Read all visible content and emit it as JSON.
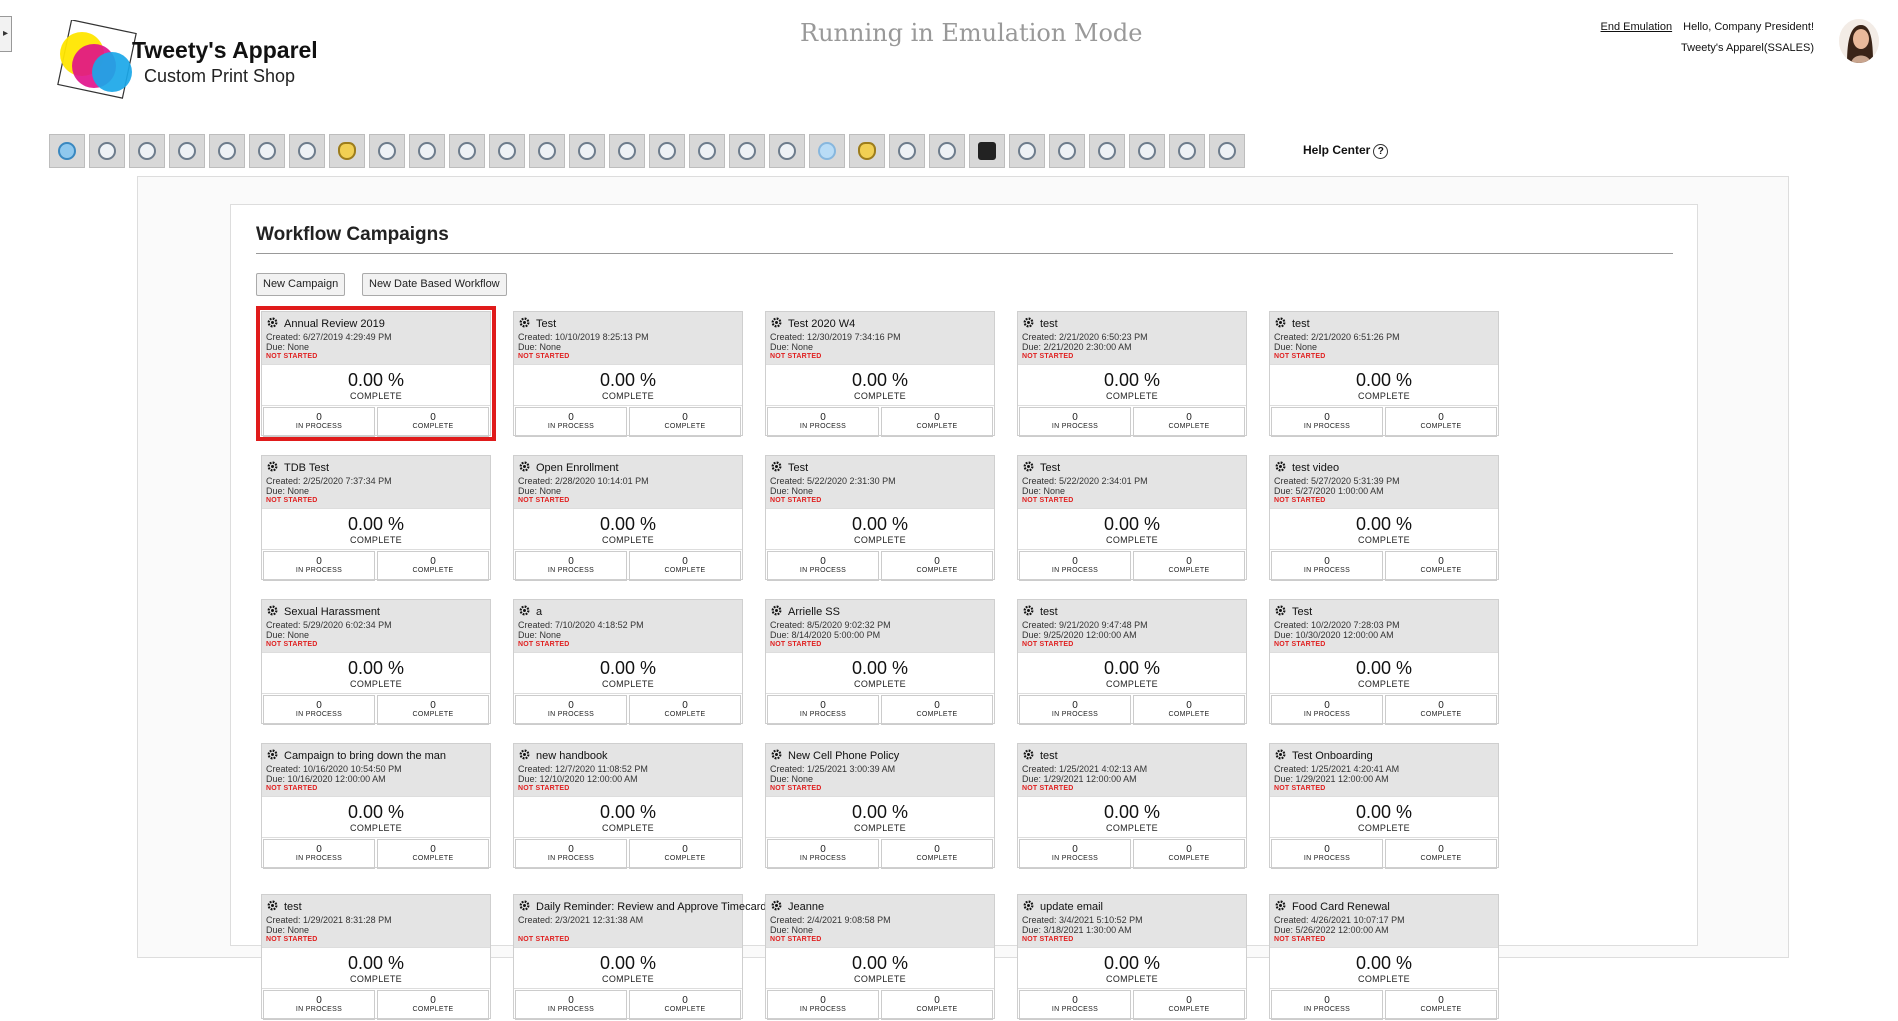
{
  "header": {
    "emulation_text": "Running in Emulation Mode",
    "end_emulation_label": "End Emulation",
    "greeting": "Hello, Company President!",
    "company": "Tweety's Apparel(SSALES)"
  },
  "logo": {
    "title": "Tweety's Apparel",
    "subtitle": "Custom Print Shop"
  },
  "toolbar": {
    "icons": [
      "home-icon",
      "award-icon",
      "settings-money-icon",
      "presentation-icon",
      "group-icon",
      "org-chart-icon",
      "document-edit-icon",
      "money-bag-icon",
      "search-people-icon",
      "target-icon",
      "target-icon",
      "growth-icon",
      "target-icon",
      "compare-icon",
      "handshake-icon",
      "shield-icon",
      "person-award-icon",
      "transfer-icon",
      "search-x-icon",
      "globe-icon",
      "money-bag-icon",
      "handshake-icon",
      "coins-icon",
      "clipboard-plus-icon",
      "shield-icon",
      "magnify-doc-icon",
      "id-card-icon",
      "document-icon",
      "team-icon",
      "inspect-icon"
    ],
    "help_label": "Help Center",
    "help_glyph": "?"
  },
  "page": {
    "title": "Workflow Campaigns",
    "new_campaign_label": "New Campaign",
    "new_date_workflow_label": "New Date Based Workflow"
  },
  "campaigns": [
    {
      "name": "Annual Review 2019",
      "created": "Created: 6/27/2019 4:29:49 PM",
      "due": "Due: None",
      "status": "NOT STARTED",
      "pct": "0.00 %",
      "pct_label": "COMPLETE",
      "in_process": "0",
      "in_process_label": "IN PROCESS",
      "complete": "0",
      "complete_label": "COMPLETE"
    },
    {
      "name": "Test",
      "created": "Created: 10/10/2019 8:25:13 PM",
      "due": "Due: None",
      "status": "NOT STARTED",
      "pct": "0.00 %",
      "pct_label": "COMPLETE",
      "in_process": "0",
      "in_process_label": "IN PROCESS",
      "complete": "0",
      "complete_label": "COMPLETE"
    },
    {
      "name": "Test 2020 W4",
      "created": "Created: 12/30/2019 7:34:16 PM",
      "due": "Due: None",
      "status": "NOT STARTED",
      "pct": "0.00 %",
      "pct_label": "COMPLETE",
      "in_process": "0",
      "in_process_label": "IN PROCESS",
      "complete": "0",
      "complete_label": "COMPLETE"
    },
    {
      "name": "test",
      "created": "Created: 2/21/2020 6:50:23 PM",
      "due": "Due: 2/21/2020 2:30:00 AM",
      "status": "NOT STARTED",
      "pct": "0.00 %",
      "pct_label": "COMPLETE",
      "in_process": "0",
      "in_process_label": "IN PROCESS",
      "complete": "0",
      "complete_label": "COMPLETE"
    },
    {
      "name": "test",
      "created": "Created: 2/21/2020 6:51:26 PM",
      "due": "Due: None",
      "status": "NOT STARTED",
      "pct": "0.00 %",
      "pct_label": "COMPLETE",
      "in_process": "0",
      "in_process_label": "IN PROCESS",
      "complete": "0",
      "complete_label": "COMPLETE"
    },
    {
      "name": "TDB Test",
      "created": "Created: 2/25/2020 7:37:34 PM",
      "due": "Due: None",
      "status": "NOT STARTED",
      "pct": "0.00 %",
      "pct_label": "COMPLETE",
      "in_process": "0",
      "in_process_label": "IN PROCESS",
      "complete": "0",
      "complete_label": "COMPLETE"
    },
    {
      "name": "Open Enrollment",
      "created": "Created: 2/28/2020 10:14:01 PM",
      "due": "Due: None",
      "status": "NOT STARTED",
      "pct": "0.00 %",
      "pct_label": "COMPLETE",
      "in_process": "0",
      "in_process_label": "IN PROCESS",
      "complete": "0",
      "complete_label": "COMPLETE"
    },
    {
      "name": "Test",
      "created": "Created: 5/22/2020 2:31:30 PM",
      "due": "Due: None",
      "status": "NOT STARTED",
      "pct": "0.00 %",
      "pct_label": "COMPLETE",
      "in_process": "0",
      "in_process_label": "IN PROCESS",
      "complete": "0",
      "complete_label": "COMPLETE"
    },
    {
      "name": "Test",
      "created": "Created: 5/22/2020 2:34:01 PM",
      "due": "Due: None",
      "status": "NOT STARTED",
      "pct": "0.00 %",
      "pct_label": "COMPLETE",
      "in_process": "0",
      "in_process_label": "IN PROCESS",
      "complete": "0",
      "complete_label": "COMPLETE"
    },
    {
      "name": "test video",
      "created": "Created: 5/27/2020 5:31:39 PM",
      "due": "Due: 5/27/2020 1:00:00 AM",
      "status": "NOT STARTED",
      "pct": "0.00 %",
      "pct_label": "COMPLETE",
      "in_process": "0",
      "in_process_label": "IN PROCESS",
      "complete": "0",
      "complete_label": "COMPLETE"
    },
    {
      "name": "Sexual Harassment",
      "created": "Created: 5/29/2020 6:02:34 PM",
      "due": "Due: None",
      "status": "NOT STARTED",
      "pct": "0.00 %",
      "pct_label": "COMPLETE",
      "in_process": "0",
      "in_process_label": "IN PROCESS",
      "complete": "0",
      "complete_label": "COMPLETE"
    },
    {
      "name": "a",
      "created": "Created: 7/10/2020 4:18:52 PM",
      "due": "Due: None",
      "status": "NOT STARTED",
      "pct": "0.00 %",
      "pct_label": "COMPLETE",
      "in_process": "0",
      "in_process_label": "IN PROCESS",
      "complete": "0",
      "complete_label": "COMPLETE"
    },
    {
      "name": "Arrielle SS",
      "created": "Created: 8/5/2020 9:02:32 PM",
      "due": "Due: 8/14/2020 5:00:00 PM",
      "status": "NOT STARTED",
      "pct": "0.00 %",
      "pct_label": "COMPLETE",
      "in_process": "0",
      "in_process_label": "IN PROCESS",
      "complete": "0",
      "complete_label": "COMPLETE"
    },
    {
      "name": "test",
      "created": "Created: 9/21/2020 9:47:48 PM",
      "due": "Due: 9/25/2020 12:00:00 AM",
      "status": "NOT STARTED",
      "pct": "0.00 %",
      "pct_label": "COMPLETE",
      "in_process": "0",
      "in_process_label": "IN PROCESS",
      "complete": "0",
      "complete_label": "COMPLETE"
    },
    {
      "name": "Test",
      "created": "Created: 10/2/2020 7:28:03 PM",
      "due": "Due: 10/30/2020 12:00:00 AM",
      "status": "NOT STARTED",
      "pct": "0.00 %",
      "pct_label": "COMPLETE",
      "in_process": "0",
      "in_process_label": "IN PROCESS",
      "complete": "0",
      "complete_label": "COMPLETE"
    },
    {
      "name": "Campaign to bring down the man",
      "created": "Created: 10/16/2020 10:54:50 PM",
      "due": "Due: 10/16/2020 12:00:00 AM",
      "status": "NOT STARTED",
      "pct": "0.00 %",
      "pct_label": "COMPLETE",
      "in_process": "0",
      "in_process_label": "IN PROCESS",
      "complete": "0",
      "complete_label": "COMPLETE"
    },
    {
      "name": "new handbook",
      "created": "Created: 12/7/2020 11:08:52 PM",
      "due": "Due: 12/10/2020 12:00:00 AM",
      "status": "NOT STARTED",
      "pct": "0.00 %",
      "pct_label": "COMPLETE",
      "in_process": "0",
      "in_process_label": "IN PROCESS",
      "complete": "0",
      "complete_label": "COMPLETE"
    },
    {
      "name": "New Cell Phone Policy",
      "created": "Created: 1/25/2021 3:00:39 AM",
      "due": "Due: None",
      "status": "NOT STARTED",
      "pct": "0.00 %",
      "pct_label": "COMPLETE",
      "in_process": "0",
      "in_process_label": "IN PROCESS",
      "complete": "0",
      "complete_label": "COMPLETE"
    },
    {
      "name": "test",
      "created": "Created: 1/25/2021 4:02:13 AM",
      "due": "Due: 1/29/2021 12:00:00 AM",
      "status": "NOT STARTED",
      "pct": "0.00 %",
      "pct_label": "COMPLETE",
      "in_process": "0",
      "in_process_label": "IN PROCESS",
      "complete": "0",
      "complete_label": "COMPLETE"
    },
    {
      "name": "Test Onboarding",
      "created": "Created: 1/25/2021 4:20:41 AM",
      "due": "Due: 1/29/2021 12:00:00 AM",
      "status": "NOT STARTED",
      "pct": "0.00 %",
      "pct_label": "COMPLETE",
      "in_process": "0",
      "in_process_label": "IN PROCESS",
      "complete": "0",
      "complete_label": "COMPLETE"
    },
    {
      "name": "test",
      "created": "Created: 1/29/2021 8:31:28 PM",
      "due": "Due: None",
      "status": "NOT STARTED",
      "pct": "0.00 %",
      "pct_label": "COMPLETE",
      "in_process": "0",
      "in_process_label": "IN PROCESS",
      "complete": "0",
      "complete_label": "COMPLETE"
    },
    {
      "name": "Daily Reminder: Review and Approve Timecards",
      "created": "Created: 2/3/2021 12:31:38 AM",
      "due": "",
      "status": "NOT STARTED",
      "pct": "0.00 %",
      "pct_label": "COMPLETE",
      "in_process": "0",
      "in_process_label": "IN PROCESS",
      "complete": "0",
      "complete_label": "COMPLETE"
    },
    {
      "name": "Jeanne",
      "created": "Created: 2/4/2021 9:08:58 PM",
      "due": "Due: None",
      "status": "NOT STARTED",
      "pct": "0.00 %",
      "pct_label": "COMPLETE",
      "in_process": "0",
      "in_process_label": "IN PROCESS",
      "complete": "0",
      "complete_label": "COMPLETE"
    },
    {
      "name": "update email",
      "created": "Created: 3/4/2021 5:10:52 PM",
      "due": "Due: 3/18/2021 1:30:00 AM",
      "status": "NOT STARTED",
      "pct": "0.00 %",
      "pct_label": "COMPLETE",
      "in_process": "0",
      "in_process_label": "IN PROCESS",
      "complete": "0",
      "complete_label": "COMPLETE"
    },
    {
      "name": "Food Card Renewal",
      "created": "Created: 4/26/2021 10:07:17 PM",
      "due": "Due: 5/26/2022 12:00:00 AM",
      "status": "NOT STARTED",
      "pct": "0.00 %",
      "pct_label": "COMPLETE",
      "in_process": "0",
      "in_process_label": "IN PROCESS",
      "complete": "0",
      "complete_label": "COMPLETE"
    }
  ]
}
